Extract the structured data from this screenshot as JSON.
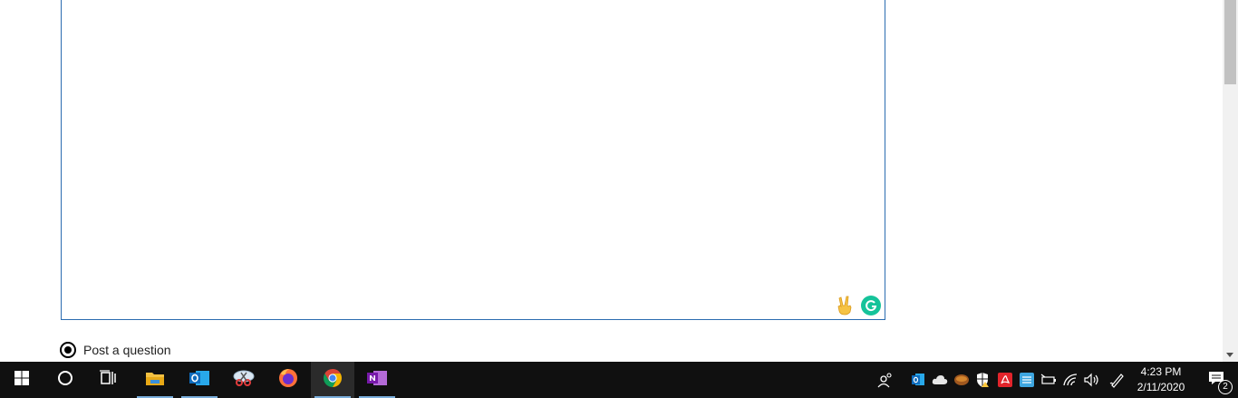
{
  "form": {
    "post_question_label": "Post a question",
    "post_question_selected": true
  },
  "taskbar": {
    "apps": [
      {
        "name": "start",
        "icon": "windows-start-icon"
      },
      {
        "name": "search",
        "icon": "cortana-circle-icon"
      },
      {
        "name": "task-view",
        "icon": "task-view-icon"
      },
      {
        "name": "file-explorer",
        "icon": "folder-icon",
        "running": true
      },
      {
        "name": "outlook",
        "icon": "outlook-icon",
        "running": true
      },
      {
        "name": "snipping-tool",
        "icon": "scissors-icon"
      },
      {
        "name": "firefox",
        "icon": "firefox-icon"
      },
      {
        "name": "chrome",
        "icon": "chrome-icon",
        "running": true,
        "active": true
      },
      {
        "name": "onenote",
        "icon": "onenote-icon",
        "running": true
      }
    ],
    "clock": {
      "time": "4:23 PM",
      "date": "2/11/2020"
    },
    "notification_count": "2"
  },
  "colors": {
    "textarea_border": "#2b6cb0",
    "grammarly": "#15c39a",
    "taskbar": "#101010",
    "running_indicator": "#7aaedc"
  }
}
